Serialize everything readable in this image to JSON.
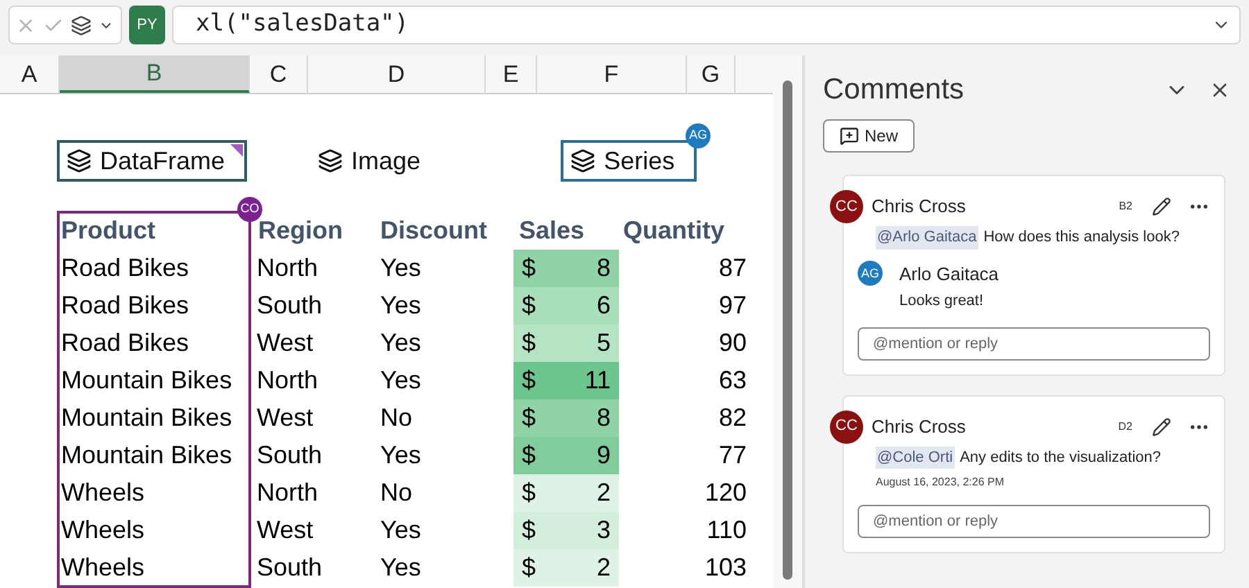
{
  "formula_bar": {
    "python_badge": "PY",
    "formula": "xl(\"salesData\")"
  },
  "columns": [
    {
      "label": "A",
      "selected": false
    },
    {
      "label": "B",
      "selected": true
    },
    {
      "label": "C",
      "selected": false
    },
    {
      "label": "D",
      "selected": false
    },
    {
      "label": "E",
      "selected": false
    },
    {
      "label": "F",
      "selected": false
    },
    {
      "label": "G",
      "selected": false
    }
  ],
  "objects": [
    {
      "label": "DataFrame",
      "kind": "selected"
    },
    {
      "label": "Image",
      "kind": "plain"
    },
    {
      "label": "Series",
      "kind": "commented",
      "badge": "AG"
    }
  ],
  "range_badge": "CO",
  "table": {
    "columns": [
      "Product",
      "Region",
      "Discount",
      "Sales",
      "Quantity"
    ],
    "rows": [
      {
        "product": "Road Bikes",
        "region": "North",
        "discount": "Yes",
        "currency": "$",
        "sales": "8",
        "color": "#8fd3a6",
        "quantity": "87"
      },
      {
        "product": "Road Bikes",
        "region": "South",
        "discount": "Yes",
        "currency": "$",
        "sales": "6",
        "color": "#a9dfba",
        "quantity": "97"
      },
      {
        "product": "Road Bikes",
        "region": "West",
        "discount": "Yes",
        "currency": "$",
        "sales": "5",
        "color": "#b5e4c4",
        "quantity": "90"
      },
      {
        "product": "Mountain Bikes",
        "region": "North",
        "discount": "Yes",
        "currency": "$",
        "sales": "11",
        "color": "#6cc58c",
        "quantity": "63"
      },
      {
        "product": "Mountain Bikes",
        "region": "West",
        "discount": "No",
        "currency": "$",
        "sales": "8",
        "color": "#8fd3a6",
        "quantity": "82"
      },
      {
        "product": "Mountain Bikes",
        "region": "South",
        "discount": "Yes",
        "currency": "$",
        "sales": "9",
        "color": "#80cd9b",
        "quantity": "77"
      },
      {
        "product": "Wheels",
        "region": "North",
        "discount": "No",
        "currency": "$",
        "sales": "2",
        "color": "#def3e5",
        "quantity": "120"
      },
      {
        "product": "Wheels",
        "region": "West",
        "discount": "Yes",
        "currency": "$",
        "sales": "3",
        "color": "#d3efdc",
        "quantity": "110"
      },
      {
        "product": "Wheels",
        "region": "South",
        "discount": "Yes",
        "currency": "$",
        "sales": "2",
        "color": "#def3e5",
        "quantity": "103"
      }
    ]
  },
  "comments_pane": {
    "title": "Comments",
    "new_button": "New",
    "threads": [
      {
        "author": "Chris Cross",
        "initials": "CC",
        "cell": "B2",
        "mention": "@Arlo Gaitaca",
        "text": "How does this analysis look?",
        "replies": [
          {
            "author": "Arlo Gaitaca",
            "initials": "AG",
            "text": "Looks great!"
          }
        ],
        "placeholder": "@mention or reply"
      },
      {
        "author": "Chris Cross",
        "initials": "CC",
        "cell": "D2",
        "mention": "@Cole Orti",
        "text": "Any edits to the visualization?",
        "date": "August 16, 2023, 2:26 PM",
        "placeholder": "@mention or reply"
      }
    ]
  }
}
